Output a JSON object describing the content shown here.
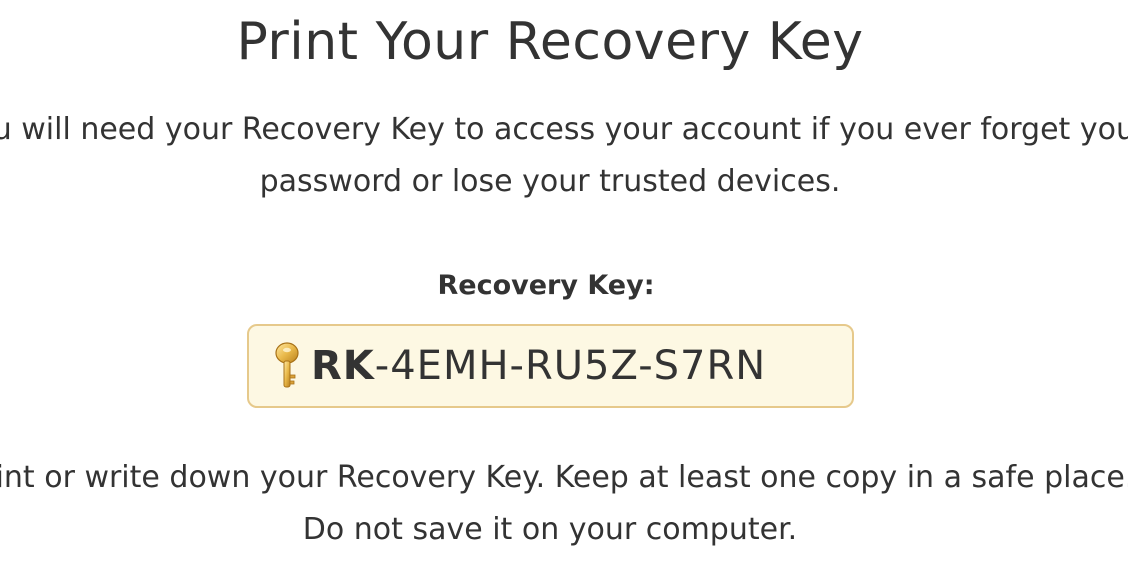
{
  "page": {
    "title": "Print Your Recovery Key",
    "description_line1": "You will need your Recovery Key to access your account if you ever forget your",
    "description_line2": "password or lose your trusted devices.",
    "recovery_key_label": "Recovery Key:",
    "recovery_key_prefix": "RK",
    "recovery_key_rest": "-4EMH-RU5Z-S7RN",
    "key_icon": "key-icon",
    "note_line1": "Print or write down your Recovery Key. Keep at least one copy in a safe place.",
    "note_line2": "Do not save it on your computer."
  },
  "colors": {
    "key_box_background": "#fdf8e3",
    "key_box_border": "#e6c98b",
    "text": "#333333"
  }
}
